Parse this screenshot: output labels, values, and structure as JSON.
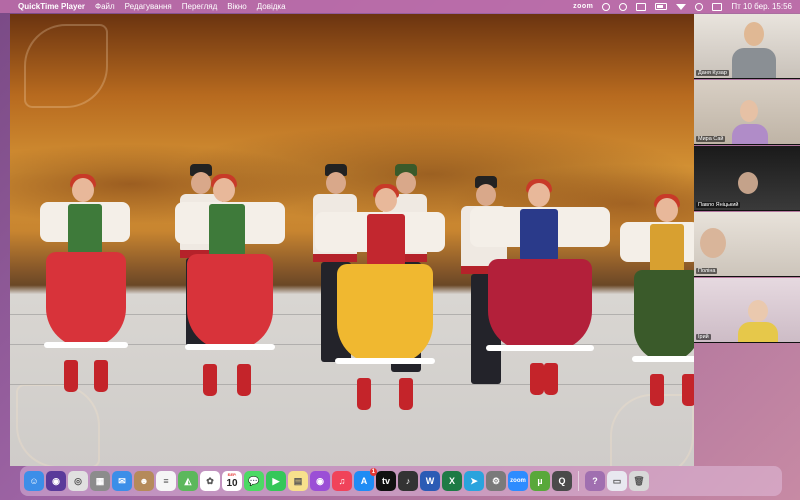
{
  "menubar": {
    "app_name": "QuickTime Player",
    "menus": [
      "Файл",
      "Редагування",
      "Перегляд",
      "Вікно",
      "Довідка"
    ],
    "zoom_label": "zoom",
    "datetime": "Пт 10 бер.  15:56",
    "status_icons": [
      "zoom-status-icon",
      "circle-status-icon",
      "record-icon",
      "keyboard-layout-icon",
      "wifi-icon",
      "search-icon",
      "control-center-icon",
      "battery-icon"
    ]
  },
  "participants": [
    {
      "name": "Даня Кузар"
    },
    {
      "name": "Мира Сай"
    },
    {
      "name": "Павло Яніцький"
    },
    {
      "name": "Поліна"
    },
    {
      "name": "Ірий"
    }
  ],
  "dock": {
    "apps": [
      {
        "name": "finder-icon",
        "color": "#3c8ee8",
        "glyph": "☺"
      },
      {
        "name": "siri-icon",
        "color": "#5a3a9a",
        "glyph": "◉"
      },
      {
        "name": "chrome-icon",
        "color": "#e0e0e0",
        "glyph": "◎"
      },
      {
        "name": "launchpad-icon",
        "color": "#8c8c8c",
        "glyph": "▦"
      },
      {
        "name": "mail-icon",
        "color": "#3c8ee8",
        "glyph": "✉"
      },
      {
        "name": "contacts-icon",
        "color": "#b58a5a",
        "glyph": "☻"
      },
      {
        "name": "reminders-icon",
        "color": "#f5f5f5",
        "glyph": "≡"
      },
      {
        "name": "maps-icon",
        "color": "#5cb85c",
        "glyph": "◭"
      },
      {
        "name": "photos-icon",
        "color": "#ffffff",
        "glyph": "✿"
      },
      {
        "name": "calendar-icon",
        "color": "#ffffff",
        "glyph": ""
      },
      {
        "name": "messages-icon",
        "color": "#4cd964",
        "glyph": "💬"
      },
      {
        "name": "facetime-icon",
        "color": "#34c759",
        "glyph": "▶"
      },
      {
        "name": "notes-icon",
        "color": "#f7e08c",
        "glyph": "▤"
      },
      {
        "name": "podcasts-icon",
        "color": "#9b4fd6",
        "glyph": "◉"
      },
      {
        "name": "music-icon",
        "color": "#f0435a",
        "glyph": "♫"
      },
      {
        "name": "app-store-icon",
        "color": "#1f8cf5",
        "glyph": "A"
      },
      {
        "name": "tv-icon",
        "color": "#111111",
        "glyph": "tv"
      },
      {
        "name": "garageband-icon",
        "color": "#333333",
        "glyph": "♪"
      },
      {
        "name": "word-icon",
        "color": "#2b5bb5",
        "glyph": "W"
      },
      {
        "name": "excel-icon",
        "color": "#1e7a45",
        "glyph": "X"
      },
      {
        "name": "telegram-icon",
        "color": "#2aa3dd",
        "glyph": "➤"
      },
      {
        "name": "system-settings-icon",
        "color": "#7a7a7a",
        "glyph": "⚙"
      },
      {
        "name": "zoom-app-icon",
        "color": "#2d8cff",
        "glyph": "zoom"
      },
      {
        "name": "utorrent-icon",
        "color": "#58a83a",
        "glyph": "µ"
      },
      {
        "name": "quicktime-icon",
        "color": "#4a4a4a",
        "glyph": "Q"
      }
    ],
    "trailing": [
      {
        "name": "help-icon",
        "color": "#a06fb0",
        "glyph": "?"
      },
      {
        "name": "folder-icon",
        "color": "#e8e8f0",
        "glyph": "▭"
      },
      {
        "name": "trash-icon",
        "color": "#d8d8d8",
        "glyph": "🗑"
      }
    ],
    "calendar": {
      "month": "БЕР.",
      "day": "10"
    },
    "app_store_badge": "1"
  },
  "colors": {
    "menubar": "#be6eaa",
    "stage_backdrop": "#c8812e",
    "floor": "#d4d1ce"
  }
}
